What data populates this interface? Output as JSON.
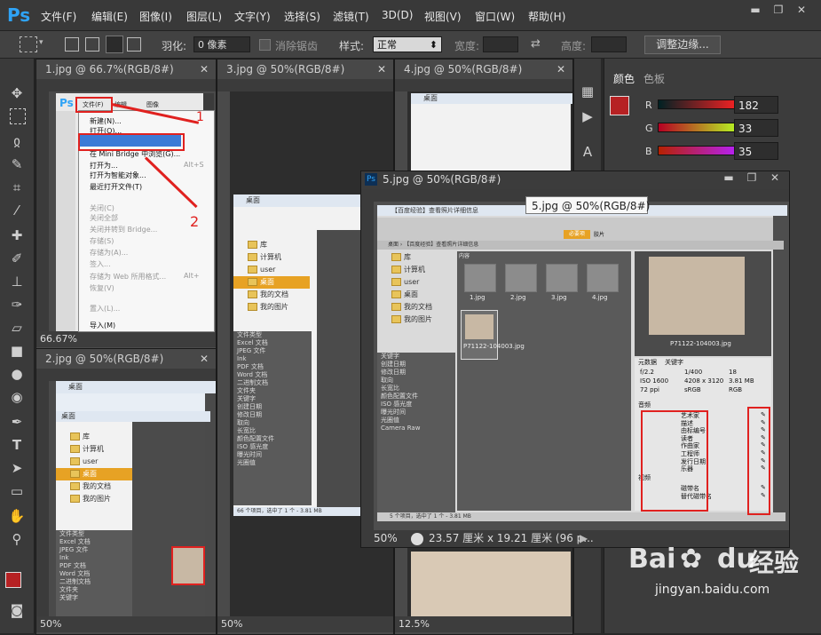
{
  "app": {
    "logo": "Ps"
  },
  "menubar": {
    "items": [
      "文件(F)",
      "编辑(E)",
      "图像(I)",
      "图层(L)",
      "文字(Y)",
      "选择(S)",
      "滤镜(T)",
      "3D(D)",
      "视图(V)",
      "窗口(W)",
      "帮助(H)"
    ]
  },
  "options": {
    "feather_label": "羽化:",
    "feather_value": "0 像素",
    "antialias_label": "消除锯齿",
    "style_label": "样式:",
    "style_value": "正常",
    "width_label": "宽度:",
    "height_label": "高度:",
    "refine_label": "调整边缘..."
  },
  "docs": {
    "doc1": {
      "tab": "1.jpg @ 66.7%(RGB/8#)",
      "zoom": "66.67%"
    },
    "doc2": {
      "tab": "2.jpg @ 50%(RGB/8#)",
      "zoom": "50%"
    },
    "doc3": {
      "tab": "3.jpg @ 50%(RGB/8#)",
      "zoom": "50%"
    },
    "doc4": {
      "tab": "4.jpg @ 50%(RGB/8#)",
      "zoom": "12.5%"
    },
    "doc5": {
      "tab": "5.jpg @ 50%(RGB/8#)",
      "zoom": "50%",
      "status": "23.57 厘米 x 19.21 厘米 (96 p..."
    }
  },
  "tooltip": "5.jpg @ 50%(RGB/8#)",
  "color_panel": {
    "tabs": [
      "颜色",
      "色板"
    ],
    "r_label": "R",
    "g_label": "G",
    "b_label": "B",
    "r": "182",
    "g": "33",
    "b": "35",
    "swatch": "#b62123"
  },
  "explorer": {
    "title": "桌面",
    "nav": [
      "库",
      "计算机",
      "user",
      "桌面",
      "我的文档",
      "我的图片"
    ],
    "filter_tabs": [
      "收藏夹",
      "文件夹"
    ],
    "filter_items": [
      "文件类型",
      "Excel 文档",
      "JPEG 文件",
      "Ink",
      "PDF 文档",
      "Word 文档",
      "二进制文档",
      "文件夹",
      "关键字",
      "创建日期",
      "修改日期",
      "取向",
      "长宽比",
      "颜色配置文件",
      "ISO 感光度",
      "曝光时间",
      "光圈值"
    ],
    "path": "桌面"
  },
  "filemenu": {
    "items": [
      "新建(N)...",
      "打开(O)...",
      "在 Bridge 中浏览(B)...",
      "在 Mini Bridge 中浏览(G)...",
      "打开为...",
      "打开为智能对象...",
      "最近打开文件(T)",
      "关闭(C)",
      "关闭全部",
      "关闭并转到 Bridge...",
      "存储(S)",
      "存储为(A)...",
      "签入...",
      "存储为 Web 所用格式...",
      "恢复(V)",
      "置入(L)...",
      "导入(M)"
    ],
    "shortcut": "Alt+",
    "shortcut2": "Alt+S",
    "file_label": "文件(F)",
    "edit_label": "编辑",
    "image_label": "图像"
  },
  "bridge": {
    "title": "【百度经验】查看照片详细信息",
    "path_text": "桌面 › 【百度经验】查看照片详细信息",
    "thumbs": [
      "1.jpg",
      "2.jpg",
      "3.jpg",
      "4.jpg"
    ],
    "selected": "P71122-104003.jpg",
    "preview_caption": "P71122-104003.jpg",
    "content_tab": "内容",
    "prefs": "必要项",
    "film": "胶片",
    "metadata_tab": "元数据",
    "keywords_tab": "关键字",
    "status": "5 个项目，选中了 1 个 - 3.81 MB",
    "meta_labels": [
      "艺术家",
      "描述",
      "由标编号",
      "读者",
      "作曲家",
      "工程师",
      "发行日期",
      "乐器"
    ],
    "video_section": "视频",
    "video_labels": [
      "磁带名",
      "替代磁带名"
    ],
    "iptc_label": "音频",
    "camera_raw": "Camera Raw",
    "meta_info": [
      "f/2.2",
      "1/400",
      "18",
      "ISO 1600",
      "4208 x 3120",
      "3.81 MB",
      "72 ppi",
      "sRGB",
      "RGB"
    ]
  },
  "explorer_status": "66 个项目，选中了 1 个 - 3.81 MB",
  "annotations": [
    "1",
    "2"
  ],
  "watermark": {
    "brand": "Bai",
    "paw": "du",
    "text": "经验",
    "url": "jingyan.baidu.com"
  }
}
